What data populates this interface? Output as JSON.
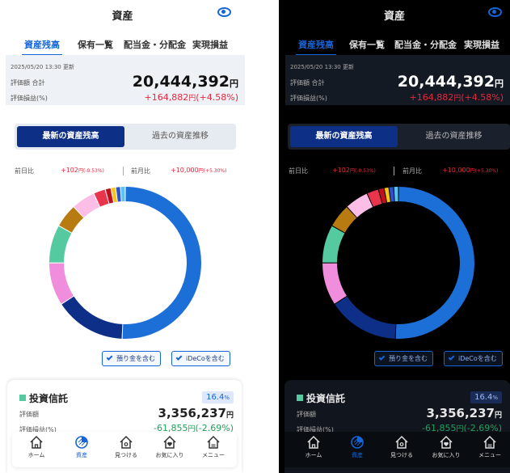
{
  "header": {
    "title": "資産"
  },
  "tabs": [
    "資産残高",
    "保有一覧",
    "配当金・分配金",
    "実現損益"
  ],
  "summary": {
    "updated": "2025/05/20 13:30 更新",
    "eval_label": "評価額 合計",
    "pl_label": "評価損益(%)",
    "total": "20,444,392",
    "yen": "円",
    "pl_value": "+164,882",
    "pl_pct": "(+4.58%)"
  },
  "segment": {
    "active": "最新の資産残高",
    "inactive": "過去の資産推移"
  },
  "comparison": {
    "prev_day_label": "前日比",
    "prev_day_value": "+102",
    "prev_day_pct": "円(-0.53%)",
    "prev_month_label": "前月比",
    "prev_month_value": "+10,000",
    "prev_month_pct": "円(+5.30%)"
  },
  "chart_data": {
    "type": "pie",
    "values": [
      50,
      15,
      9,
      8,
      5,
      5,
      2.5,
      1.2,
      1,
      1,
      1
    ],
    "colors": [
      "#1d6fd8",
      "#0e2f87",
      "#f08edd",
      "#55c9a0",
      "#b87b12",
      "#fcbde6",
      "#e8354c",
      "#c01020",
      "#f6c61a",
      "#2f50d1",
      "#58c3f2"
    ]
  },
  "chips": {
    "deposit": "預り金を含む",
    "ideco": "iDeCoを含む"
  },
  "card": {
    "name": "投資信託",
    "pct": "16.4",
    "pct_unit": "%",
    "eval_label": "評価額",
    "pl_label": "評価損益(%)",
    "eval_value": "3,356,237",
    "yen": "円",
    "pl_value": "-61,855",
    "pl_pct": "(-2.69%)"
  },
  "nav": [
    "ホーム",
    "資産",
    "見つける",
    "お気に入り",
    "メニュー"
  ]
}
